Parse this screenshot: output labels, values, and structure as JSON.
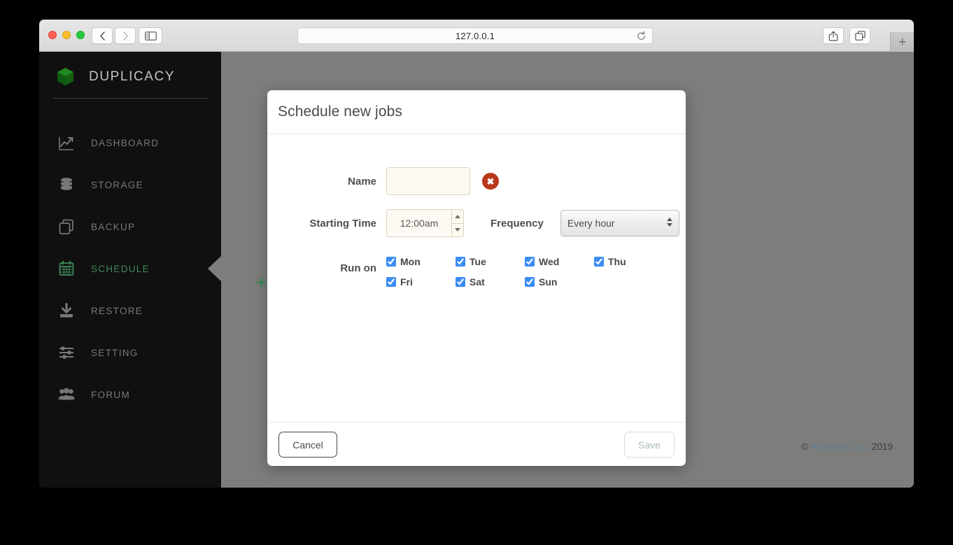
{
  "browser": {
    "address": "127.0.0.1",
    "back_icon": "chevron-left-icon",
    "forward_icon": "chevron-right-icon",
    "sidebar_icon": "sidebar-toggle-icon",
    "reload_icon": "reload-icon",
    "share_icon": "share-icon",
    "tabs_icon": "tabs-icon",
    "new_tab_label": "+"
  },
  "sidebar": {
    "brand": "DUPLICACY",
    "items": [
      {
        "label": "DASHBOARD",
        "icon": "chart-line-icon",
        "active": false
      },
      {
        "label": "STORAGE",
        "icon": "database-icon",
        "active": false
      },
      {
        "label": "BACKUP",
        "icon": "copy-icon",
        "active": false
      },
      {
        "label": "SCHEDULE",
        "icon": "calendar-icon",
        "active": true
      },
      {
        "label": "RESTORE",
        "icon": "download-icon",
        "active": false
      },
      {
        "label": "SETTING",
        "icon": "sliders-icon",
        "active": false
      },
      {
        "label": "FORUM",
        "icon": "people-icon",
        "active": false
      }
    ]
  },
  "content": {
    "add_button_label": "+",
    "footer": {
      "symbol": "©",
      "company": "Acrosync LLC",
      "year": "2019"
    }
  },
  "modal": {
    "title": "Schedule new jobs",
    "name": {
      "label": "Name",
      "value": "",
      "placeholder": "",
      "error_icon": "error-close-icon",
      "error_glyph": "✖"
    },
    "starting_time": {
      "label": "Starting Time",
      "value": "12:00am",
      "spinner_up_icon": "spinner-up-icon",
      "spinner_down_icon": "spinner-down-icon"
    },
    "frequency": {
      "label": "Frequency",
      "selected": "Every hour",
      "options": [
        "Every hour"
      ],
      "arrows_icon": "select-arrows-icon"
    },
    "run_on": {
      "label": "Run on",
      "days": [
        {
          "label": "Mon",
          "checked": true
        },
        {
          "label": "Tue",
          "checked": true
        },
        {
          "label": "Wed",
          "checked": true
        },
        {
          "label": "Thu",
          "checked": true
        },
        {
          "label": "Fri",
          "checked": true
        },
        {
          "label": "Sat",
          "checked": true
        },
        {
          "label": "Sun",
          "checked": true
        }
      ]
    },
    "footer": {
      "cancel_label": "Cancel",
      "save_label": "Save"
    }
  },
  "colors": {
    "accent_green": "#3f8a5b",
    "sidebar_bg": "#101010",
    "overlay_gray": "#7d7d7b",
    "error_red": "#b8371a",
    "checkbox_blue": "#3b8cf5"
  }
}
